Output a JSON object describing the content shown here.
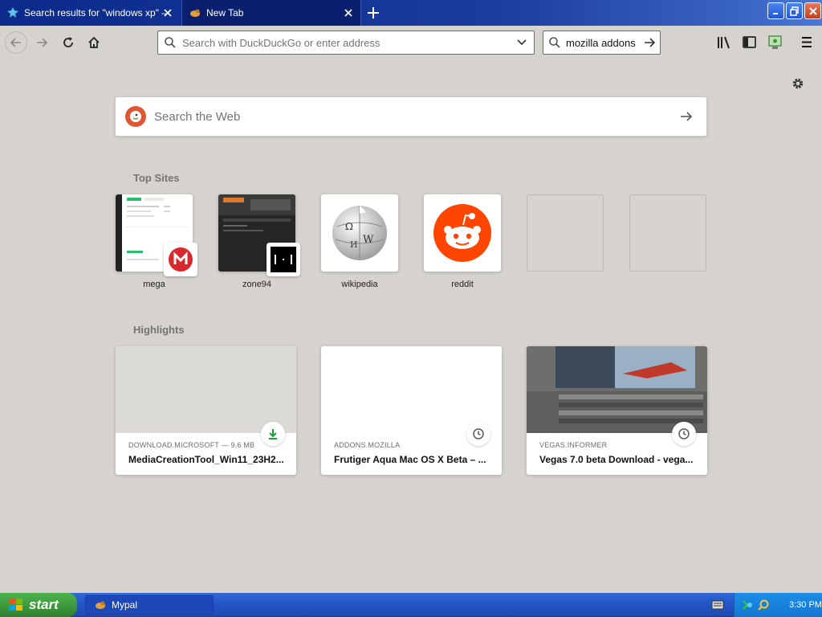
{
  "tabs": [
    {
      "title": "Search results for \"windows xp\" –",
      "active": false
    },
    {
      "title": "New Tab",
      "active": true
    }
  ],
  "toolbar": {
    "url_placeholder": "Search with DuckDuckGo or enter address",
    "search_value": "mozilla addons"
  },
  "newtab": {
    "search_placeholder": "Search the Web",
    "top_sites_heading": "Top Sites",
    "highlights_heading": "Highlights",
    "top_sites": [
      {
        "label": "mega"
      },
      {
        "label": "zone94"
      },
      {
        "label": "wikipedia"
      },
      {
        "label": "reddit"
      }
    ],
    "highlights": [
      {
        "source": "DOWNLOAD.MICROSOFT — 9.6 MB",
        "title": "MediaCreationTool_Win11_23H2...",
        "badge": "download-icon"
      },
      {
        "source": "ADDONS.MOZILLA",
        "title": "Frutiger Aqua Mac OS X Beta – ...",
        "badge": "clock-icon"
      },
      {
        "source": "VEGAS.INFORMER",
        "title": "Vegas 7.0 beta Download - vega...",
        "badge": "clock-icon"
      }
    ]
  },
  "taskbar": {
    "start_label": "start",
    "task_label": "Mypal",
    "clock": "3:30 PM"
  },
  "colors": {
    "tab_strip": "#0b2a8a",
    "content_bg": "#d6d3ce",
    "reddit": "#ff4500",
    "mega": "#d9272e",
    "duckduckgo": "#de5833",
    "taskbar": "#2456c7",
    "start_button": "#3c963c"
  }
}
